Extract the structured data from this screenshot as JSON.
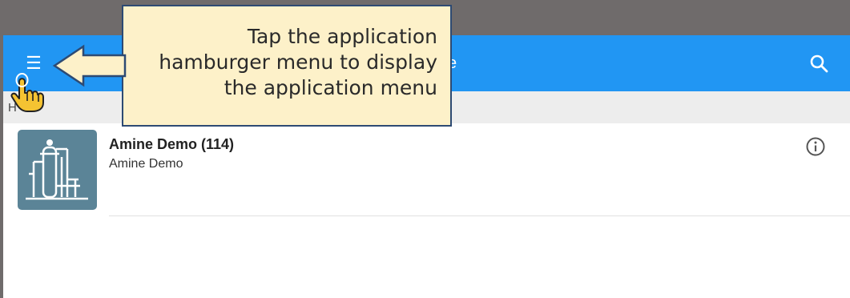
{
  "appbar": {
    "menu_icon": "hamburger-icon",
    "title_fragment": "e",
    "search_icon": "search-icon"
  },
  "breadcrumb": {
    "text": "H"
  },
  "list": {
    "items": [
      {
        "title": "Amine Demo (114)",
        "subtitle": "Amine Demo",
        "thumbnail_icon": "plant-tower-icon",
        "info_icon": "info-icon"
      }
    ]
  },
  "callout": {
    "text": "Tap the application\nhamburger menu to display\nthe application menu",
    "pointer_icon": "pointing-hand-icon"
  },
  "colors": {
    "appbar": "#2196f3",
    "callout_bg": "#fdf1c9",
    "callout_border": "#2d4a73",
    "thumbnail_bg": "#5b8497",
    "backdrop": "#6f6b6b"
  }
}
